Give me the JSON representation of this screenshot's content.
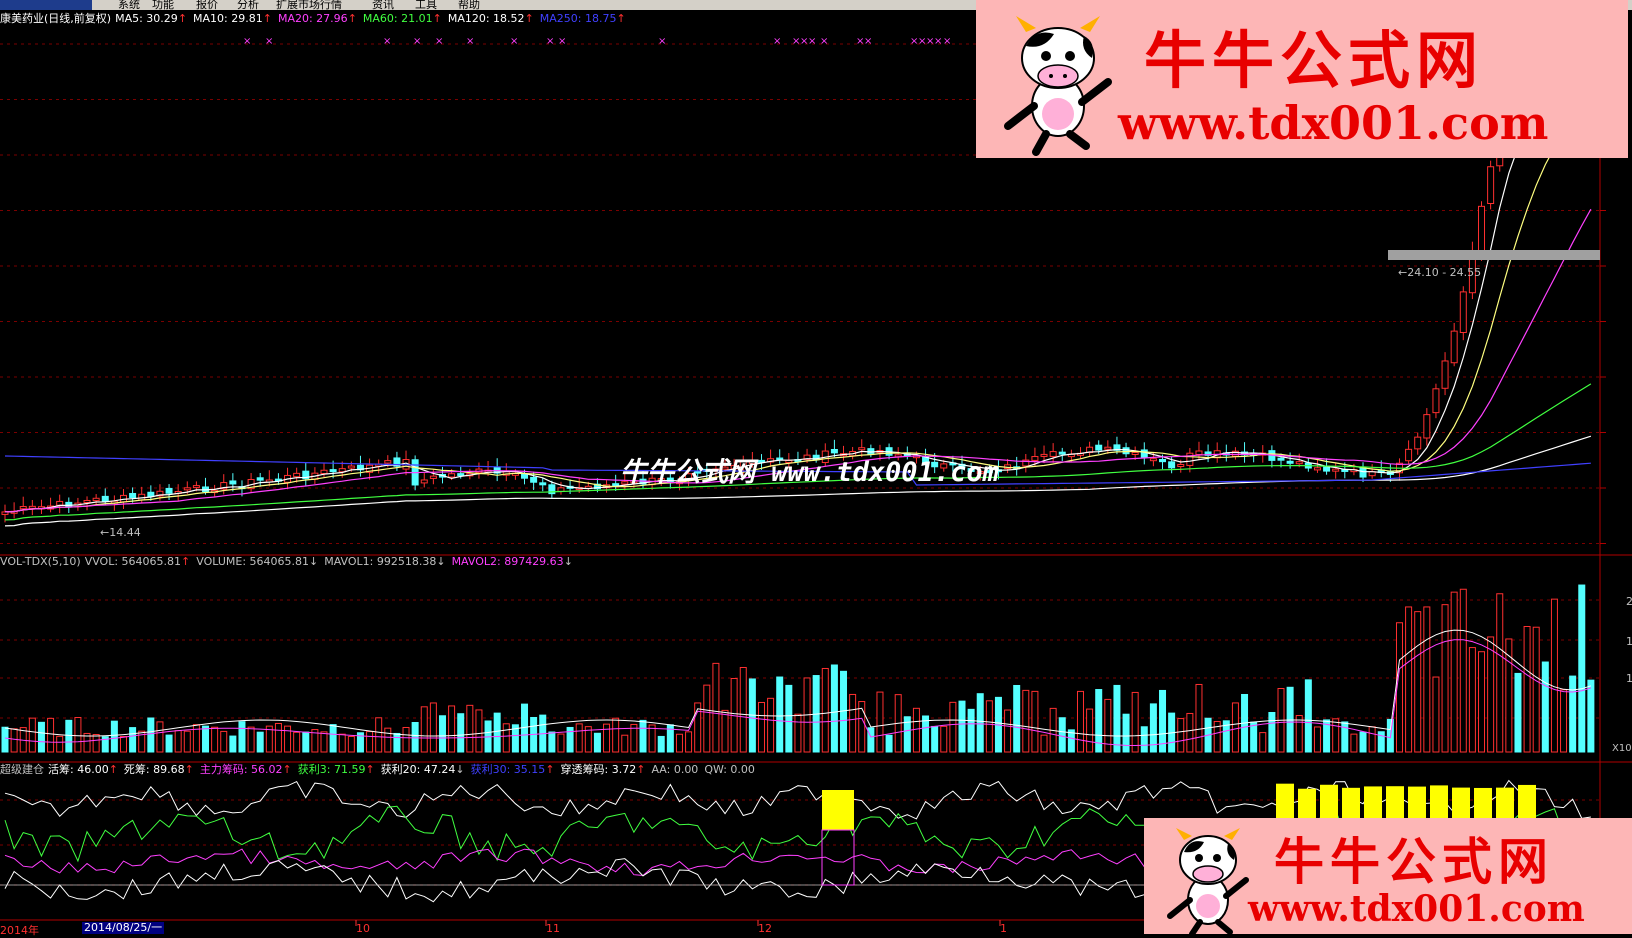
{
  "menu": {
    "items": [
      "系统",
      "功能",
      "报价",
      "分析",
      "扩展市场行情",
      "资讯",
      "工具",
      "帮助"
    ]
  },
  "price_panel": {
    "stock_title": "康美药业(日线,前复权)",
    "ma": [
      {
        "label": "MA5: 30.29",
        "color": "#ffffff",
        "arrow": "↑",
        "dir": "up"
      },
      {
        "label": "MA10: 29.81",
        "color": "#ffffff",
        "arrow": "↑",
        "dir": "up"
      },
      {
        "label": "MA20: 27.96",
        "color": "#ff40ff",
        "arrow": "↑",
        "dir": "up"
      },
      {
        "label": "MA60: 21.01",
        "color": "#40ff40",
        "arrow": "↑",
        "dir": "up"
      },
      {
        "label": "MA120: 18.52",
        "color": "#ffffff",
        "arrow": "↑",
        "dir": "up"
      },
      {
        "label": "MA250: 18.75",
        "color": "#4040ff",
        "arrow": "↑",
        "dir": "up"
      }
    ],
    "low_label": "14.44",
    "range_label": "24.10 - 24.55"
  },
  "volume_panel": {
    "name": "VOL-TDX(5,10)",
    "items": [
      {
        "label": "VVOL: 564065.81",
        "color": "#c0c0c0",
        "arrow": "↑",
        "dir": "up"
      },
      {
        "label": "VOLUME: 564065.81",
        "color": "#c0c0c0",
        "arrow": "↓",
        "dir": "down"
      },
      {
        "label": "MAVOL1: 992518.38",
        "color": "#c0c0c0",
        "arrow": "↓",
        "dir": "down"
      },
      {
        "label": "MAVOL2: 897429.63",
        "color": "#ff40ff",
        "arrow": "↓",
        "dir": "down"
      }
    ],
    "axis_labels": [
      "2",
      "1",
      "1"
    ],
    "unit": "X10"
  },
  "indicator_panel": {
    "name": "超级建仓",
    "items": [
      {
        "label": "活筹: 46.00",
        "color": "#ffffff",
        "arrow": "↑",
        "dir": "up"
      },
      {
        "label": "死筹: 89.68",
        "color": "#ffffff",
        "arrow": "↑",
        "dir": "up"
      },
      {
        "label": "主力筹码: 56.02",
        "color": "#ff40ff",
        "arrow": "↑",
        "dir": "up"
      },
      {
        "label": "获利3: 71.59",
        "color": "#40ff40",
        "arrow": "↑",
        "dir": "up"
      },
      {
        "label": "获利20: 47.24",
        "color": "#ffffff",
        "arrow": "↓",
        "dir": "down"
      },
      {
        "label": "获利30: 35.15",
        "color": "#4040ff",
        "arrow": "↑",
        "dir": "up"
      },
      {
        "label": "穿透筹码: 3.72",
        "color": "#ffffff",
        "arrow": "↑",
        "dir": "up"
      },
      {
        "label": "AA: 0.00",
        "color": "#c0c0c0",
        "arrow": "",
        "dir": "none"
      },
      {
        "label": "QW: 0.00",
        "color": "#c0c0c0",
        "arrow": "",
        "dir": "none"
      }
    ]
  },
  "date_axis": {
    "labels": [
      "2014年",
      "2014/08/25/一",
      "10",
      "11",
      "12",
      "1"
    ]
  },
  "banner_top": {
    "title": "牛牛公式网",
    "url": "www.tdx001.com"
  },
  "banner_bottom": {
    "title": "牛牛公式网",
    "url": "www.tdx001.com"
  },
  "watermark": "牛牛公式网 www.tdx001.com",
  "colors": {
    "up": "#ff3030",
    "down": "#54ffff",
    "background": "#000000",
    "grid": "#800000",
    "mascot": "cow-icon"
  }
}
